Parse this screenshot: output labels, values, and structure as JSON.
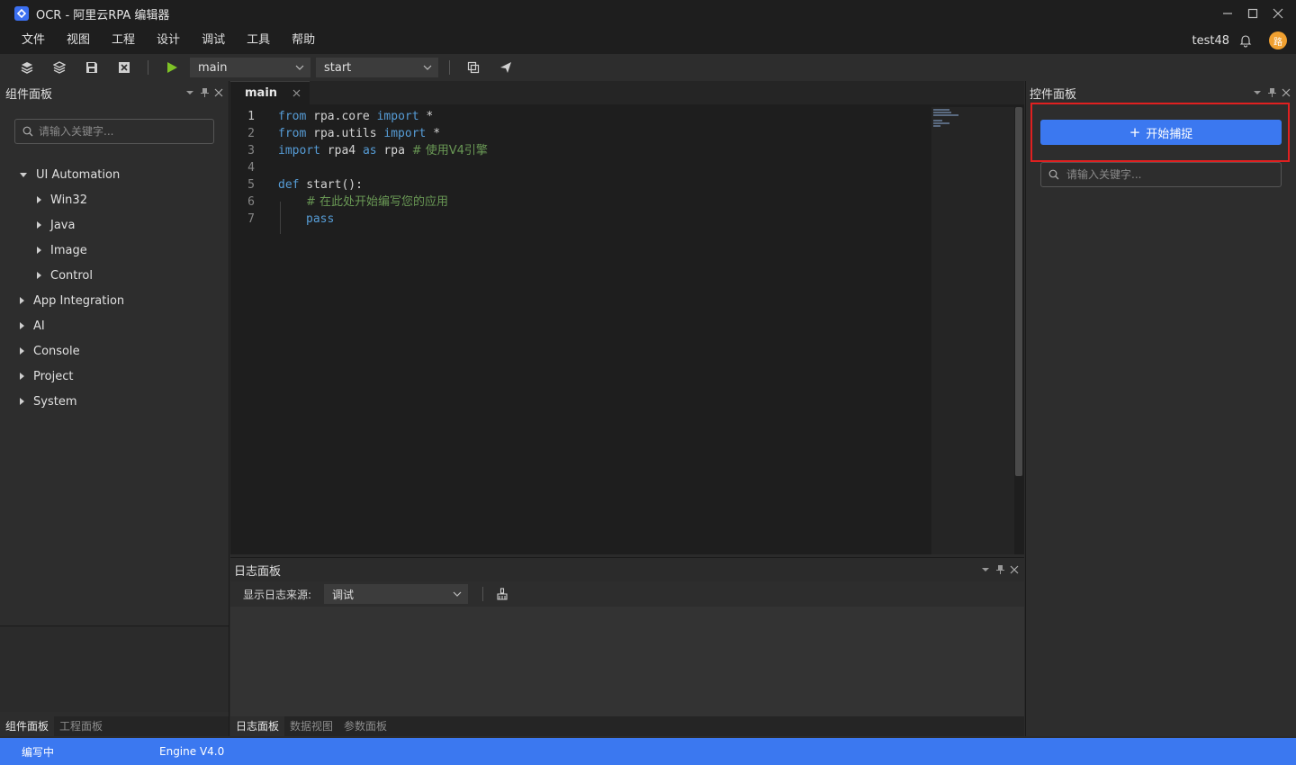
{
  "window": {
    "title": "OCR - 阿里云RPA 编辑器"
  },
  "menu": {
    "items": [
      "文件",
      "视图",
      "工程",
      "设计",
      "调试",
      "工具",
      "帮助"
    ]
  },
  "user": {
    "name": "test48",
    "avatar_text": "路"
  },
  "toolbar": {
    "file_select": "main",
    "function_select": "start"
  },
  "left_panel": {
    "title": "组件面板",
    "search_placeholder": "请输入关键字...",
    "tree": [
      {
        "label": "UI Automation",
        "expanded": true,
        "level": 0
      },
      {
        "label": "Win32",
        "expanded": false,
        "level": 1
      },
      {
        "label": "Java",
        "expanded": false,
        "level": 1
      },
      {
        "label": "Image",
        "expanded": false,
        "level": 1
      },
      {
        "label": "Control",
        "expanded": false,
        "level": 1
      },
      {
        "label": "App Integration",
        "expanded": false,
        "level": 0
      },
      {
        "label": "AI",
        "expanded": false,
        "level": 0
      },
      {
        "label": "Console",
        "expanded": false,
        "level": 0
      },
      {
        "label": "Project",
        "expanded": false,
        "level": 0
      },
      {
        "label": "System",
        "expanded": false,
        "level": 0
      }
    ],
    "bottom_tabs": [
      "组件面板",
      "工程面板"
    ]
  },
  "editor": {
    "tab_label": "main",
    "line_numbers": [
      "1",
      "2",
      "3",
      "4",
      "5",
      "6",
      "7"
    ],
    "code": {
      "l1_kw1": "from",
      "l1_mod": " rpa.core ",
      "l1_kw2": "import",
      "l1_rest": " *",
      "l2_kw1": "from",
      "l2_mod": " rpa.utils ",
      "l2_kw2": "import",
      "l2_rest": " *",
      "l3_kw1": "import",
      "l3_mod": " rpa4 ",
      "l3_kw2": "as",
      "l3_rest": " rpa ",
      "l3_comment": "# 使用V4引擎",
      "l5_kw": "def",
      "l5_rest": " start():",
      "l6_comment": "# 在此处开始编写您的应用",
      "l7_kw": "pass"
    }
  },
  "log_panel": {
    "title": "日志面板",
    "source_label": "显示日志来源:",
    "source_value": "调试",
    "bottom_tabs": [
      "日志面板",
      "数据视图",
      "参数面板"
    ]
  },
  "right_panel": {
    "title": "控件面板",
    "capture_button": "开始捕捉",
    "search_placeholder": "请输入关键字..."
  },
  "status": {
    "state": "编写中",
    "engine": "Engine V4.0"
  },
  "colors": {
    "accent": "#3b78f0",
    "highlight": "#e02020",
    "keyword": "#569cd6",
    "comment": "#6a9955"
  }
}
